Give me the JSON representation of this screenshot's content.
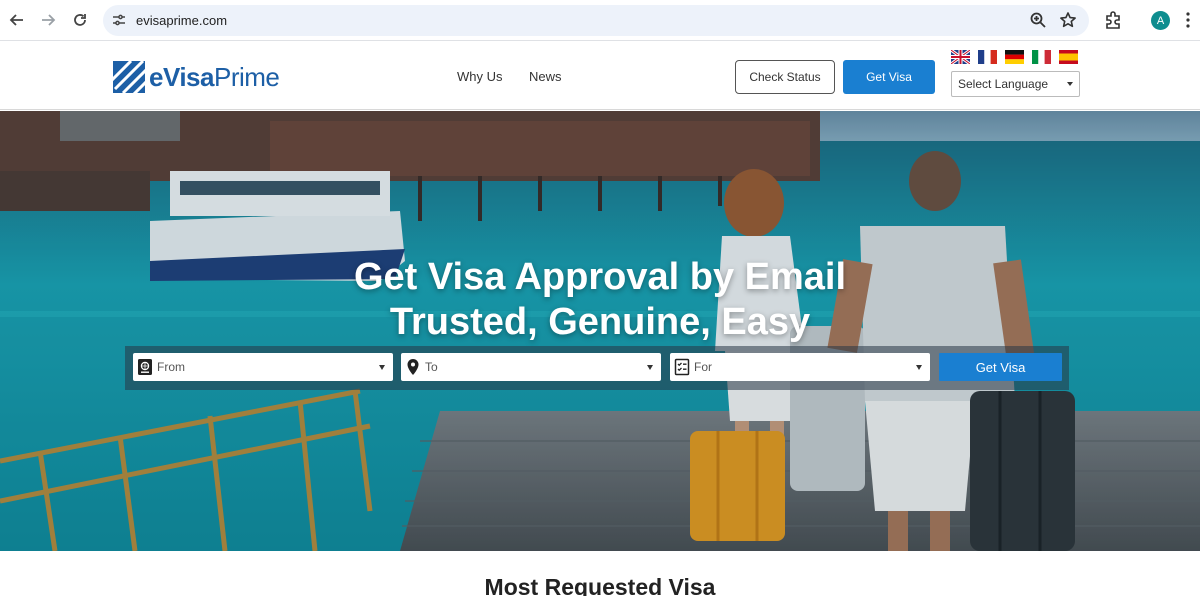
{
  "browser": {
    "url": "evisaprime.com",
    "profile_initial": "A",
    "icons": [
      "back-icon",
      "forward-icon",
      "reload-icon",
      "site-info-icon",
      "zoom-icon",
      "bookmark-star-icon",
      "extensions-icon",
      "menu-icon"
    ]
  },
  "header": {
    "logo_text_bold": "eVisa",
    "logo_text_rest": "Prime",
    "nav": [
      "Why Us",
      "News"
    ],
    "check_status_label": "Check Status",
    "get_visa_label": "Get Visa",
    "flags": [
      "uk-flag",
      "france-flag",
      "germany-flag",
      "italy-flag",
      "spain-flag"
    ],
    "language_select": "Select Language"
  },
  "hero": {
    "title_line1": "Get Visa Approval by Email",
    "title_line2": "Trusted, Genuine, Easy",
    "fields": [
      {
        "label": "From",
        "icon": "passport-icon"
      },
      {
        "label": "To",
        "icon": "location-pin-icon"
      },
      {
        "label": "For",
        "icon": "checklist-icon"
      }
    ],
    "submit_label": "Get Visa"
  },
  "section": {
    "title": "Most Requested Visa"
  },
  "colors": {
    "brand_blue": "#1a7fd1",
    "logo_blue": "#1d5fa6",
    "sea": "#1aa6b5"
  }
}
